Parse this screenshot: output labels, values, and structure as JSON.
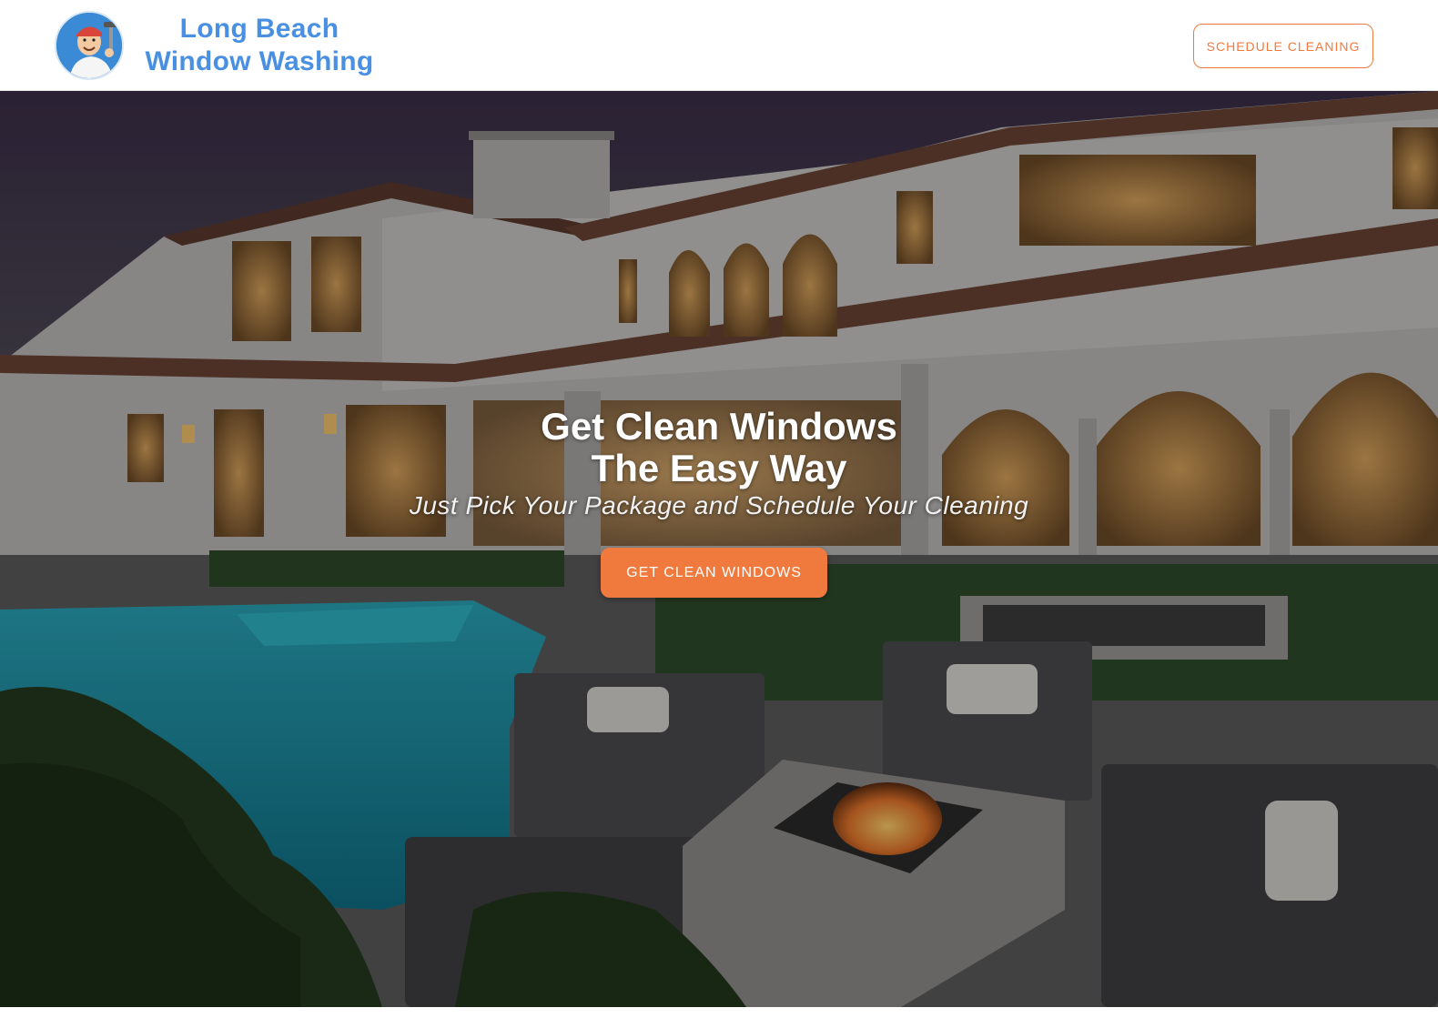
{
  "header": {
    "logo_line1": "Long Beach",
    "logo_line2": "Window Washing",
    "schedule_label": "SCHEDULE CLEANING"
  },
  "hero": {
    "title_line1": "Get Clean Windows",
    "title_line2": "The Easy Way",
    "subtitle": "Just Pick Your Package and Schedule Your Cleaning",
    "cta_label": "GET CLEAN WINDOWS"
  },
  "colors": {
    "brand_blue": "#4a90e2",
    "accent_orange": "#f07a3e",
    "white": "#ffffff"
  },
  "icons": {
    "logo": "window-washer-mascot-icon"
  }
}
